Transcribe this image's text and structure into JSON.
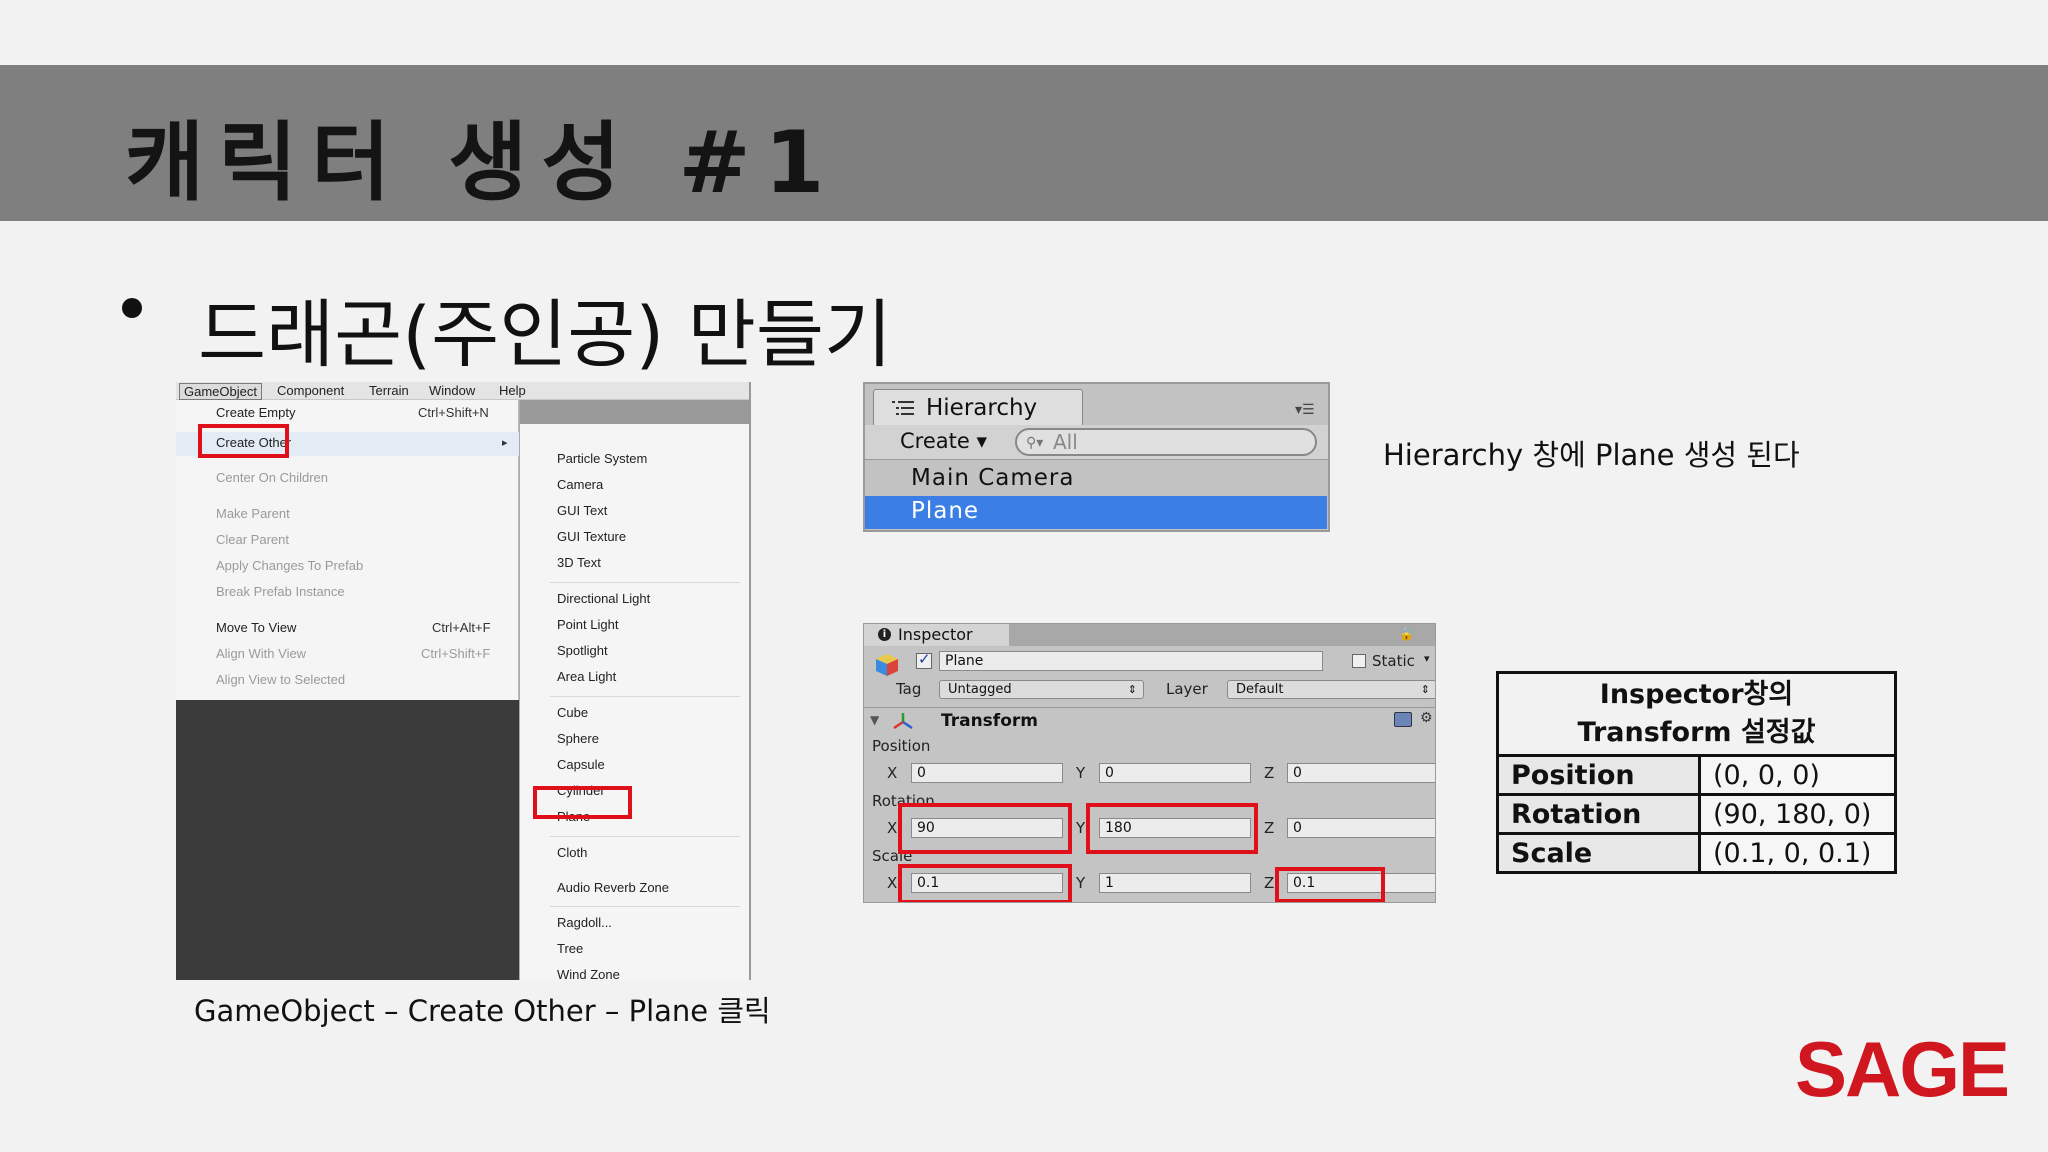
{
  "slide": {
    "title": "캐릭터 생성 #1",
    "bullet": "드래곤(주인공) 만들기",
    "logo": "SAGE",
    "logo_color": "#d0171f",
    "highlight_color": "#e0101a"
  },
  "menu_screenshot": {
    "menubar": [
      "GameObject",
      "Component",
      "Terrain",
      "Window",
      "Help"
    ],
    "left_menu": {
      "create_empty": "Create Empty",
      "create_empty_shortcut": "Ctrl+Shift+N",
      "create_other": "Create Other",
      "center_on_children": "Center On Children",
      "make_parent": "Make Parent",
      "clear_parent": "Clear Parent",
      "apply_changes": "Apply Changes To Prefab",
      "break_prefab": "Break Prefab Instance",
      "move_to_view": "Move To View",
      "move_to_view_shortcut": "Ctrl+Alt+F",
      "align_with_view": "Align With View",
      "align_with_view_shortcut": "Ctrl+Shift+F",
      "align_view_to_selected": "Align View to Selected"
    },
    "submenu": [
      "Particle System",
      "Camera",
      "GUI Text",
      "GUI Texture",
      "3D Text",
      "Directional Light",
      "Point Light",
      "Spotlight",
      "Area Light",
      "Cube",
      "Sphere",
      "Capsule",
      "Cylinder",
      "Plane",
      "Cloth",
      "Audio Reverb Zone",
      "Ragdoll...",
      "Tree",
      "Wind Zone"
    ],
    "caption": "GameObject – Create Other – Plane 클릭"
  },
  "hierarchy": {
    "tab_label": "Hierarchy",
    "create_label": "Create ▾",
    "search_placeholder": "All",
    "rows": [
      "Main Camera",
      "Plane"
    ],
    "selected_row": "Plane",
    "selection_color": "#3b7fe6",
    "caption": "Hierarchy 창에 Plane 생성 된다"
  },
  "inspector": {
    "tab_label": "Inspector",
    "object_name": "Plane",
    "static_label": "Static",
    "tag_label": "Tag",
    "tag_value": "Untagged",
    "layer_label": "Layer",
    "layer_value": "Default",
    "component": "Transform",
    "position_label": "Position",
    "rotation_label": "Rotation",
    "scale_label": "Scale",
    "axis_x": "X",
    "axis_y": "Y",
    "axis_z": "Z",
    "position": {
      "x": "0",
      "y": "0",
      "z": "0"
    },
    "rotation": {
      "x": "90",
      "y": "180",
      "z": "0"
    },
    "scale": {
      "x": "0.1",
      "y": "1",
      "z": "0.1"
    }
  },
  "table": {
    "header_line1": "Inspector창의",
    "header_line2": "Transform 설정값",
    "rows": [
      {
        "key": "Position",
        "value": "(0, 0, 0)"
      },
      {
        "key": "Rotation",
        "value": "(90, 180, 0)"
      },
      {
        "key": "Scale",
        "value": "(0.1, 0, 0.1)"
      }
    ]
  }
}
